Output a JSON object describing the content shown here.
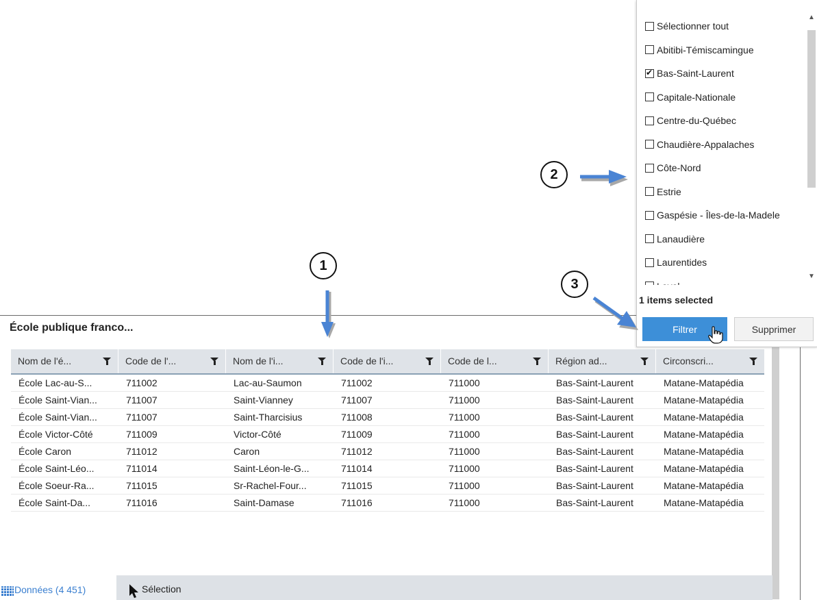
{
  "panel": {
    "title": "École publique franco..."
  },
  "table": {
    "columns": [
      {
        "label": "Nom de l'é..."
      },
      {
        "label": "Code de l'..."
      },
      {
        "label": "Nom de l'i..."
      },
      {
        "label": "Code de l'i..."
      },
      {
        "label": "Code de l..."
      },
      {
        "label": "Région ad..."
      },
      {
        "label": "Circonscri..."
      }
    ],
    "rows": [
      [
        "École Lac-au-S...",
        "711002",
        "Lac-au-Saumon",
        "711002",
        "711000",
        "Bas-Saint-Laurent",
        "Matane-Matapédia"
      ],
      [
        "École Saint-Vian...",
        "711007",
        "Saint-Vianney",
        "711007",
        "711000",
        "Bas-Saint-Laurent",
        "Matane-Matapédia"
      ],
      [
        "École Saint-Vian...",
        "711007",
        "Saint-Tharcisius",
        "711008",
        "711000",
        "Bas-Saint-Laurent",
        "Matane-Matapédia"
      ],
      [
        "École Victor-Côté",
        "711009",
        "Victor-Côté",
        "711009",
        "711000",
        "Bas-Saint-Laurent",
        "Matane-Matapédia"
      ],
      [
        "École Caron",
        "711012",
        "Caron",
        "711012",
        "711000",
        "Bas-Saint-Laurent",
        "Matane-Matapédia"
      ],
      [
        "École Saint-Léo...",
        "711014",
        "Saint-Léon-le-G...",
        "711014",
        "711000",
        "Bas-Saint-Laurent",
        "Matane-Matapédia"
      ],
      [
        "École Soeur-Ra...",
        "711015",
        "Sr-Rachel-Four...",
        "711015",
        "711000",
        "Bas-Saint-Laurent",
        "Matane-Matapédia"
      ],
      [
        "École Saint-Da...",
        "711016",
        "Saint-Damase",
        "711016",
        "711000",
        "Bas-Saint-Laurent",
        "Matane-Matapédia"
      ]
    ]
  },
  "tabs": {
    "data_label": "Données (4 451)",
    "selection_label": "Sélection"
  },
  "filter": {
    "items": [
      {
        "label": "Sélectionner tout",
        "checked": false
      },
      {
        "label": "Abitibi-Témiscamingue",
        "checked": false
      },
      {
        "label": "Bas-Saint-Laurent",
        "checked": true
      },
      {
        "label": "Capitale-Nationale",
        "checked": false
      },
      {
        "label": "Centre-du-Québec",
        "checked": false
      },
      {
        "label": "Chaudière-Appalaches",
        "checked": false
      },
      {
        "label": "Côte-Nord",
        "checked": false
      },
      {
        "label": "Estrie",
        "checked": false
      },
      {
        "label": "Gaspésie - Îles-de-la-Madele",
        "checked": false
      },
      {
        "label": "Lanaudière",
        "checked": false
      },
      {
        "label": "Laurentides",
        "checked": false
      },
      {
        "label": "Laval",
        "checked": false
      }
    ],
    "selected_count": "1 items selected",
    "filter_button": "Filtrer",
    "delete_button": "Supprimer"
  },
  "callouts": {
    "one": "1",
    "two": "2",
    "three": "3"
  },
  "colors": {
    "accent": "#3d8fd8",
    "arrow": "#4a84d4",
    "header_bg": "#dfe3e8"
  }
}
